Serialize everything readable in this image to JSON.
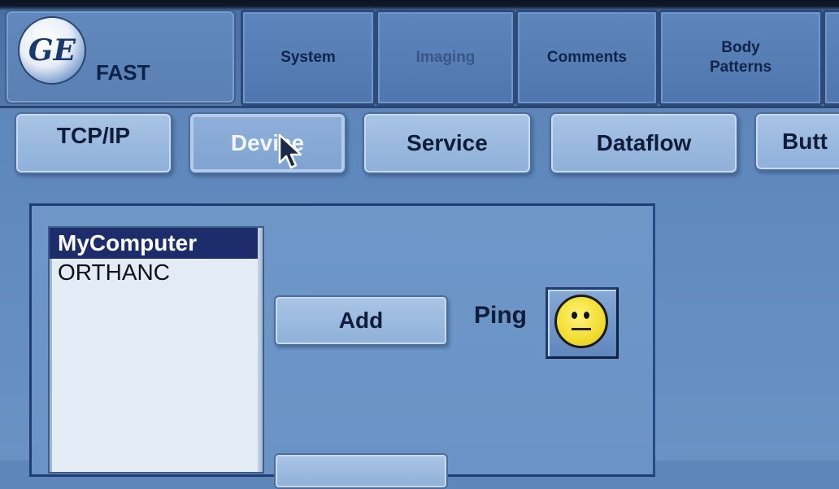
{
  "header": {
    "logo_text": "GE",
    "product": "FAST",
    "tabs": [
      {
        "label": "System",
        "state": "normal"
      },
      {
        "label": "Imaging",
        "state": "dim"
      },
      {
        "label": "Comments",
        "state": "normal"
      },
      {
        "label": "Body Patterns",
        "state": "normal"
      }
    ]
  },
  "subtabs": [
    {
      "label": "TCP/IP",
      "active": false
    },
    {
      "label": "Device",
      "active": true
    },
    {
      "label": "Service",
      "active": false
    },
    {
      "label": "Dataflow",
      "active": false
    },
    {
      "label": "Butt",
      "active": false
    }
  ],
  "device_list": {
    "items": [
      {
        "label": "MyComputer",
        "selected": true
      },
      {
        "label": "ORTHANC",
        "selected": false
      }
    ]
  },
  "actions": {
    "add_label": "Add",
    "ping_label": "Ping",
    "ping_icon": "neutral-face-icon"
  },
  "colors": {
    "background": "#5f86b8",
    "selection": "#1d2d6b",
    "smiley": "#f1dd30"
  }
}
